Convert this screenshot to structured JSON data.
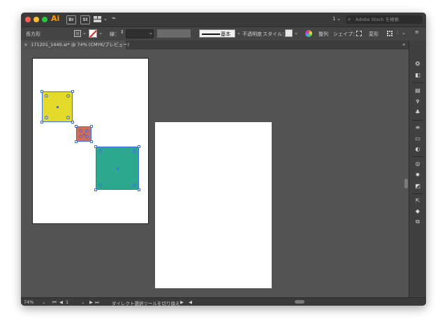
{
  "app": {
    "name": "Ai",
    "bridge_label": "Br",
    "stock_label": "St",
    "page_count": "1",
    "search_placeholder": "Adobe Stock を検索"
  },
  "control_bar": {
    "object_type": "長方形",
    "stroke_label": "線：",
    "stroke_style": "基本",
    "opacity_label": "不透明度",
    "style_label": "スタイル：",
    "align_label": "整列",
    "shape_label": "シェイプ：",
    "transform_label": "変形"
  },
  "document_tab": {
    "title": "171201_1440.ai* @ 74% (CMYK/プレビュー)",
    "close": "×"
  },
  "status_bar": {
    "zoom": "74%",
    "artboard_number": "1",
    "status_text": "ダイレクト選択ツールを切り換え"
  },
  "colors": {
    "yellow": "#e3da2a",
    "red": "#cf6e5c",
    "teal": "#2ca88e",
    "selection": "#3f6fe0"
  }
}
